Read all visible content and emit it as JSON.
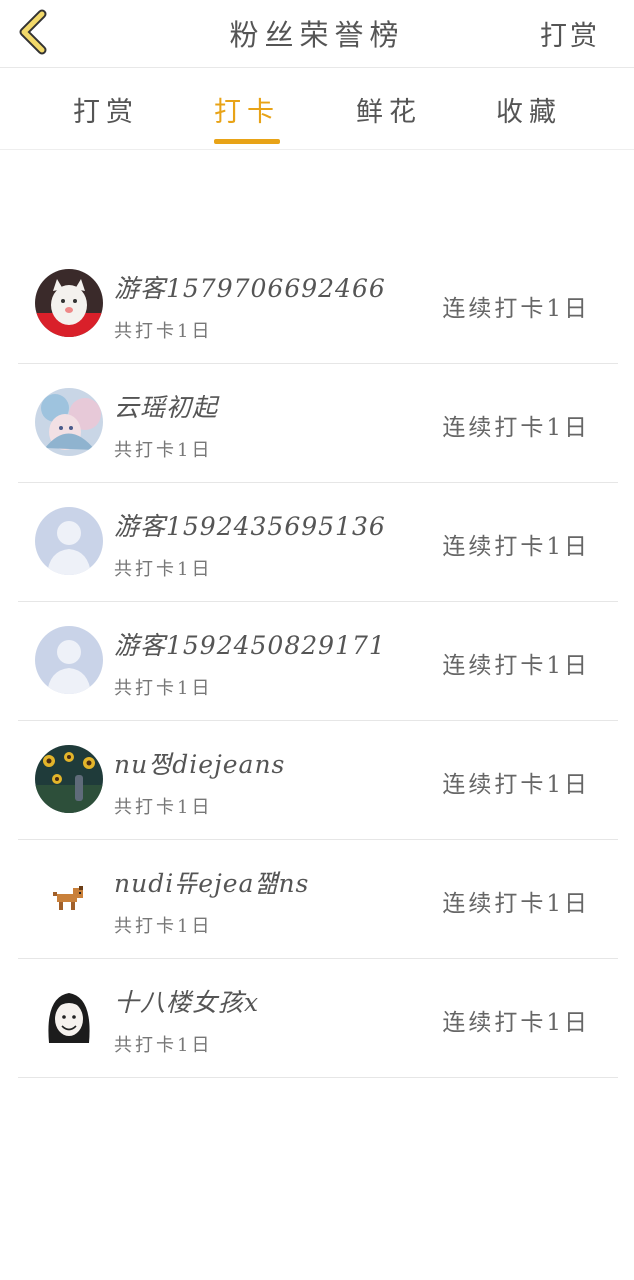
{
  "header": {
    "title": "粉丝荣誉榜",
    "right_label": "打赏"
  },
  "tabs": [
    {
      "label": "打赏",
      "active": false
    },
    {
      "label": "打卡",
      "active": true
    },
    {
      "label": "鲜花",
      "active": false
    },
    {
      "label": "收藏",
      "active": false
    }
  ],
  "colors": {
    "accent": "#e8a317",
    "text": "#555555",
    "divider": "#e6e6e6"
  },
  "list": [
    {
      "name": "游客1579706692466",
      "total": "共打卡1日",
      "streak": "连续打卡1日",
      "avatar": "white-kitten-avatar"
    },
    {
      "name": "云瑶初起",
      "total": "共打卡1日",
      "streak": "连续打卡1日",
      "avatar": "anime-girl-avatar"
    },
    {
      "name": "游客1592435695136",
      "total": "共打卡1日",
      "streak": "连续打卡1日",
      "avatar": "default-user-avatar"
    },
    {
      "name": "游客1592450829171",
      "total": "共打卡1日",
      "streak": "连续打卡1日",
      "avatar": "default-user-avatar"
    },
    {
      "name": "nu쩡diejeans",
      "total": "共打卡1日",
      "streak": "连续打卡1日",
      "avatar": "sunflower-scene-avatar"
    },
    {
      "name": "nudi뜌ejea쨺ns",
      "total": "共打卡1日",
      "streak": "连续打卡1日",
      "avatar": "pixel-dog-avatar"
    },
    {
      "name": "十八楼女孩x",
      "total": "共打卡1日",
      "streak": "连续打卡1日",
      "avatar": "cartoon-girl-avatar"
    }
  ]
}
